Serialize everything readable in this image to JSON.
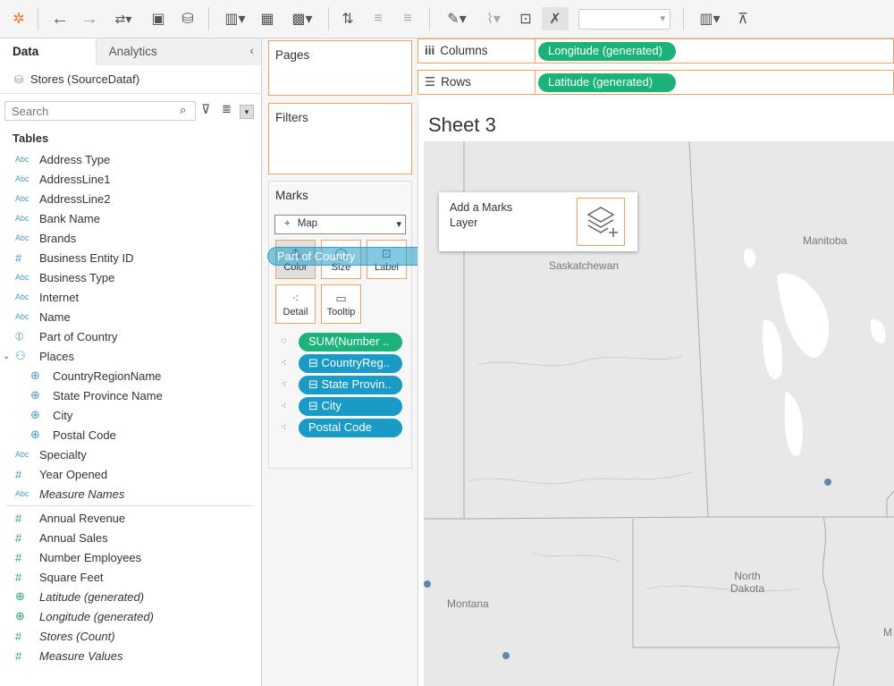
{
  "toolbar": {
    "icons": [
      "tableau-logo-icon",
      "undo-icon",
      "redo-icon",
      "swap-icon",
      "save-icon",
      "new-datasource-icon",
      "new-sheet-icon",
      "duplicate-icon",
      "clear-icon",
      "swap-rows-cols-icon",
      "sort-asc-icon",
      "sort-desc-icon",
      "highlight-icon",
      "group-icon",
      "label-icon",
      "fix-axes-icon",
      "show-me-icon",
      "presentation-icon"
    ],
    "combo_value": ""
  },
  "left_pane": {
    "tabs": [
      {
        "label": "Data"
      },
      {
        "label": "Analytics"
      }
    ],
    "datasource": "Stores (SourceDataf)",
    "search_placeholder": "Search",
    "tables_heading": "Tables",
    "fields": [
      {
        "type": "Abc",
        "name": "Address Type"
      },
      {
        "type": "Abc",
        "name": "AddressLine1"
      },
      {
        "type": "Abc",
        "name": "AddressLine2"
      },
      {
        "type": "Abc",
        "name": "Bank Name"
      },
      {
        "type": "Abc",
        "name": "Brands"
      },
      {
        "type": "#",
        "name": "Business Entity ID"
      },
      {
        "type": "Abc",
        "name": "Business Type"
      },
      {
        "type": "Abc",
        "name": "Internet"
      },
      {
        "type": "Abc",
        "name": "Name"
      },
      {
        "type": "⦶",
        "name": "Part of Country"
      },
      {
        "type": "⚇",
        "name": "Places"
      },
      {
        "type": "⊕",
        "name": "CountryRegionName"
      },
      {
        "type": "⊕",
        "name": "State Province Name"
      },
      {
        "type": "⊕",
        "name": "City"
      },
      {
        "type": "⊕",
        "name": "Postal Code"
      },
      {
        "type": "Abc",
        "name": "Specialty"
      },
      {
        "type": "#",
        "name": "Year Opened"
      },
      {
        "type": "Abc",
        "name": "Measure Names"
      }
    ],
    "measures": [
      {
        "type": "#",
        "name": "Annual Revenue"
      },
      {
        "type": "#",
        "name": "Annual Sales"
      },
      {
        "type": "#",
        "name": "Number Employees"
      },
      {
        "type": "#",
        "name": "Square Feet"
      },
      {
        "type": "⊕",
        "name": "Latitude (generated)"
      },
      {
        "type": "⊕",
        "name": "Longitude (generated)"
      },
      {
        "type": "#",
        "name": "Stores (Count)"
      },
      {
        "type": "#",
        "name": "Measure Values"
      }
    ]
  },
  "cards": {
    "pages": "Pages",
    "filters": "Filters",
    "marks": "Marks",
    "mark_type": "Map",
    "buttons": [
      "Color",
      "Size",
      "Label",
      "Detail",
      "Tooltip"
    ],
    "pills": [
      "SUM(Number ..",
      "⊟ CountryReg..",
      "⊟ State Provin..",
      "⊟ City",
      "Postal Code"
    ],
    "drag_pill": "Part of Country"
  },
  "shelves": {
    "columns_label": "Columns",
    "columns_pill": "Longitude (generated)",
    "rows_label": "Rows",
    "rows_pill": "Latitude (generated)"
  },
  "viz": {
    "sheet_title": "Sheet 3",
    "marks_layer_text": "Add a Marks Layer",
    "map_labels": [
      "Saskatchewan",
      "Manitoba",
      "North Dakota",
      "Montana",
      "M"
    ]
  },
  "colors": {
    "accent": "#f4a261",
    "green_pill": "#1bb37a",
    "blue_pill": "#1a9bc7",
    "map_bg": "#e8e8e8"
  }
}
